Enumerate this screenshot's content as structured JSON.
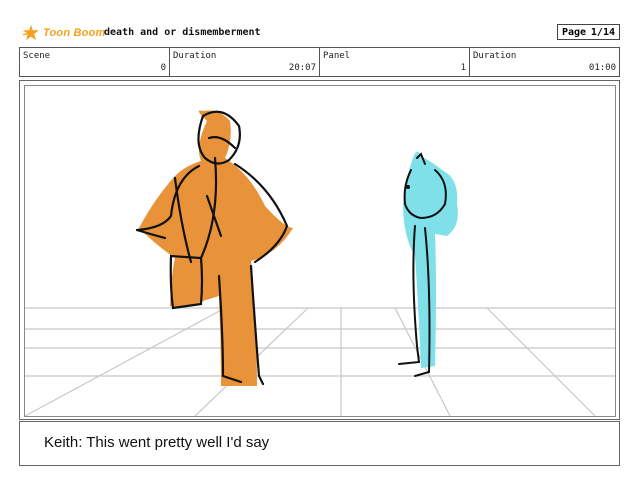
{
  "header": {
    "logo_text": "Toon Boom",
    "document_title": "death and or dismemberment",
    "page_label": "Page",
    "page_value": "1/14"
  },
  "info": {
    "scene_label": "Scene",
    "scene_value": "0",
    "scene_duration_label": "Duration",
    "scene_duration_value": "20:07",
    "panel_label": "Panel",
    "panel_value": "1",
    "panel_duration_label": "Duration",
    "panel_duration_value": "01:00"
  },
  "panel": {
    "colors": {
      "orange_figure": "#e8933a",
      "cyan_figure": "#7fe0ea",
      "ink": "#111111",
      "floor_grid": "#c8c8c8"
    }
  },
  "dialog": {
    "text": "Keith: This went pretty well I'd say"
  }
}
